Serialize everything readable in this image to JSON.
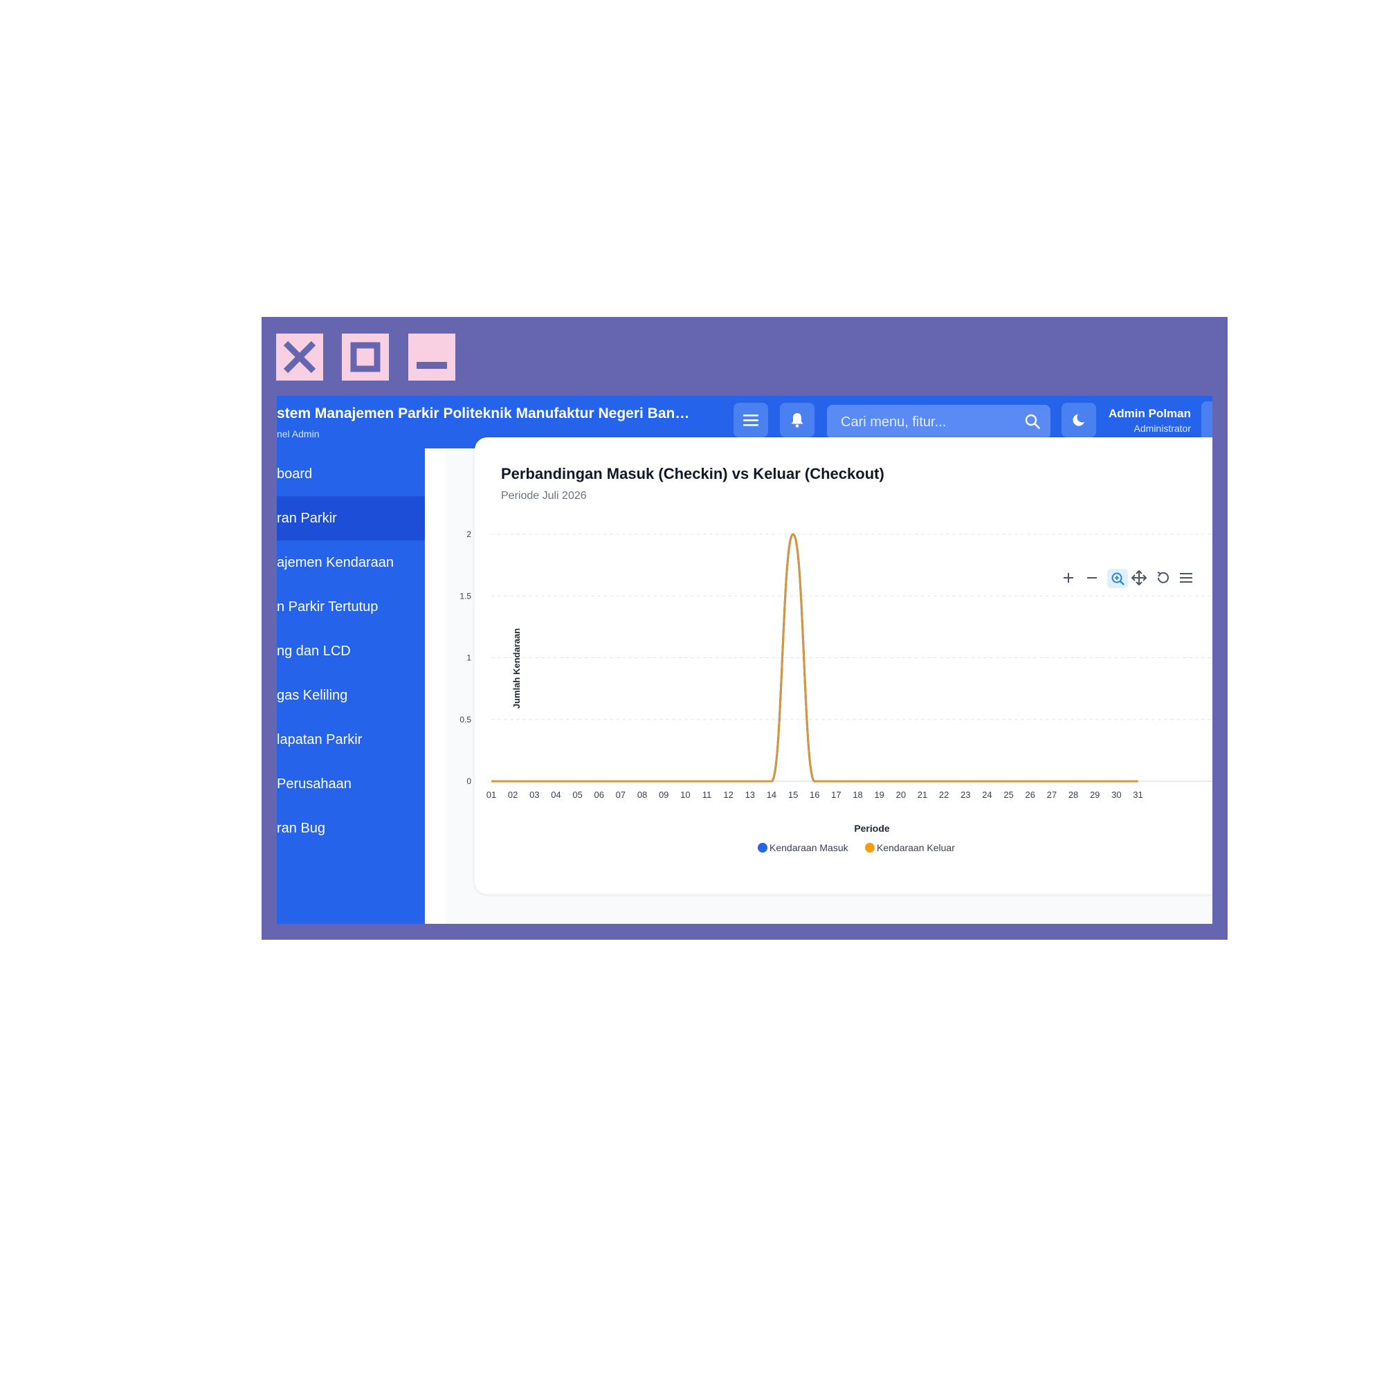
{
  "window": {
    "buttons": [
      "close",
      "maximize",
      "minimize"
    ]
  },
  "header": {
    "title": "stem Manajemen Parkir Politeknik Manufaktur Negeri Ban…",
    "subtitle": "nel Admin",
    "search_placeholder": "Cari menu, fitur...",
    "user_name": "Admin Polman",
    "user_role": "Administrator"
  },
  "sidebar": {
    "items": [
      {
        "label": "board",
        "active": false
      },
      {
        "label": "ran Parkir",
        "active": true
      },
      {
        "label": "ajemen Kendaraan",
        "active": false
      },
      {
        "label": "n Parkir Tertutup",
        "active": false
      },
      {
        "label": "ng dan LCD",
        "active": false
      },
      {
        "label": "gas Keliling",
        "active": false
      },
      {
        "label": "lapatan Parkir",
        "active": false
      },
      {
        "label": " Perusahaan",
        "active": false
      },
      {
        "label": "ran Bug",
        "active": false
      }
    ]
  },
  "card": {
    "title": "Perbandingan Masuk (Checkin) vs Keluar (Checkout)",
    "subtitle": "Periode Juli 2026"
  },
  "chart_data": {
    "type": "line",
    "title": "Perbandingan Masuk (Checkin) vs Keluar (Checkout)",
    "subtitle": "Periode Juli 2026",
    "xlabel": "Periode",
    "ylabel": "Jumlah Kendaraan",
    "x": [
      "01",
      "02",
      "03",
      "04",
      "05",
      "06",
      "07",
      "08",
      "09",
      "10",
      "11",
      "12",
      "13",
      "14",
      "15",
      "16",
      "17",
      "18",
      "19",
      "20",
      "21",
      "22",
      "23",
      "24",
      "25",
      "26",
      "27",
      "28",
      "29",
      "30",
      "31"
    ],
    "ylim": [
      0,
      2
    ],
    "yticks": [
      "0",
      "0.5",
      "1",
      "1.5",
      "2"
    ],
    "grid": true,
    "legend_position": "bottom",
    "series": [
      {
        "name": "Kendaraan Masuk",
        "color": "#2563eb",
        "values": [
          0,
          0,
          0,
          0,
          0,
          0,
          0,
          0,
          0,
          0,
          0,
          0,
          0,
          0,
          2,
          0,
          0,
          0,
          0,
          0,
          0,
          0,
          0,
          0,
          0,
          0,
          0,
          0,
          0,
          0,
          0
        ]
      },
      {
        "name": "Kendaraan Keluar",
        "color": "#f59e0b",
        "values": [
          0,
          0,
          0,
          0,
          0,
          0,
          0,
          0,
          0,
          0,
          0,
          0,
          0,
          0,
          2,
          0,
          0,
          0,
          0,
          0,
          0,
          0,
          0,
          0,
          0,
          0,
          0,
          0,
          0,
          0,
          0
        ]
      }
    ],
    "toolbar": [
      "zoom-in",
      "zoom-out",
      "selection-zoom",
      "pan",
      "reset",
      "menu"
    ]
  },
  "colors": {
    "primary": "#2563eb",
    "sidebar_active": "#1d4ed8",
    "frame": "#6666b0",
    "window_button": "#f9cfe2",
    "overlap_line": "#d4973b"
  }
}
